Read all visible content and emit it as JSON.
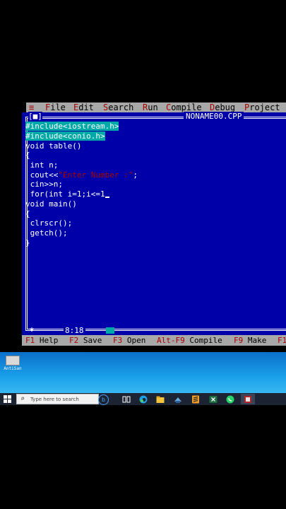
{
  "menu": {
    "system": "≡",
    "items": [
      "File",
      "Edit",
      "Search",
      "Run",
      "Compile",
      "Debug",
      "Project"
    ]
  },
  "editor": {
    "window_marker": "[■]",
    "title": "NONAME00.CPP",
    "lines": [
      "#include<iostream.h>",
      "#include<conio.h>",
      "void table()",
      "{",
      " int n;",
      " cout<<",
      " cin>>n;",
      " for(int i=1;i<=1",
      "void main()",
      "{",
      " clrscr();",
      " getch();",
      "}"
    ],
    "cout_string": "\"Enter Number :\"",
    "cout_tail": ";",
    "cursor_position": "8:18"
  },
  "fkeys": [
    {
      "key": "F1",
      "label": "Help"
    },
    {
      "key": "F2",
      "label": "Save"
    },
    {
      "key": "F3",
      "label": "Open"
    },
    {
      "key": "Alt-F9",
      "label": "Compile"
    },
    {
      "key": "F9",
      "label": "Make"
    },
    {
      "key": "F1",
      "label": ""
    }
  ],
  "desktop": {
    "icon_label": "AntiSan"
  },
  "taskbar": {
    "search_placeholder": "Type here to search",
    "icons": [
      "task-view-icon",
      "edge-icon",
      "file-explorer-icon",
      "app-icon",
      "sublime-icon",
      "whatsapp-icon",
      "turbo-cpp-icon"
    ]
  },
  "colors": {
    "editor_bg": "#0000a8",
    "menu_bg": "#a8a8a8",
    "hotkey": "#a80000",
    "selection": "#00a8a8"
  }
}
